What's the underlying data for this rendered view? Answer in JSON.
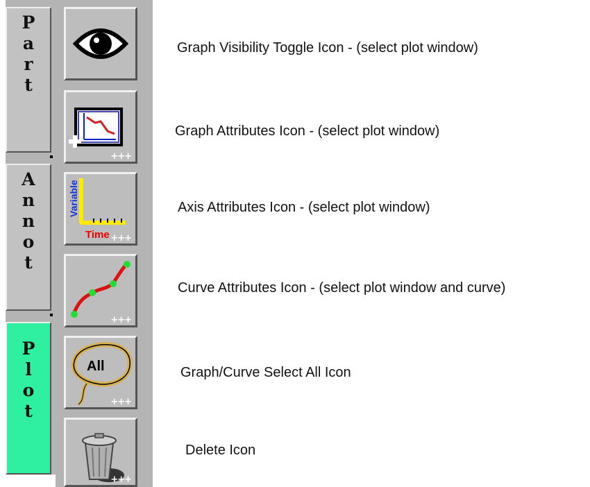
{
  "tabs": [
    {
      "letters": [
        "P",
        "a",
        "r",
        "t"
      ],
      "active": false
    },
    {
      "letters": [
        "A",
        "n",
        "n",
        "o",
        "t"
      ],
      "active": false
    },
    {
      "letters": [
        "P",
        "l",
        "o",
        "t"
      ],
      "active": true
    }
  ],
  "buttons": [
    {
      "icon": "eye-icon"
    },
    {
      "icon": "graph-attributes-icon"
    },
    {
      "icon": "axis-attributes-icon",
      "ylabel": "Variable",
      "xlabel": "Time"
    },
    {
      "icon": "curve-attributes-icon"
    },
    {
      "icon": "select-all-icon",
      "label": "All"
    },
    {
      "icon": "trash-can-icon"
    }
  ],
  "more_indicator": "+++",
  "descriptions": [
    "Graph Visibility Toggle Icon   -   (select plot window)",
    "Graph Attributes Icon   -   (select plot window)",
    "Axis Attributes Icon   -   (select plot window)",
    "Curve Attributes Icon   -   (select plot window and curve)",
    "Graph/Curve Select All Icon",
    "Delete Icon"
  ],
  "colors": {
    "active_tab": "#2ef0a0",
    "toolbar": "#b4b4b4"
  }
}
